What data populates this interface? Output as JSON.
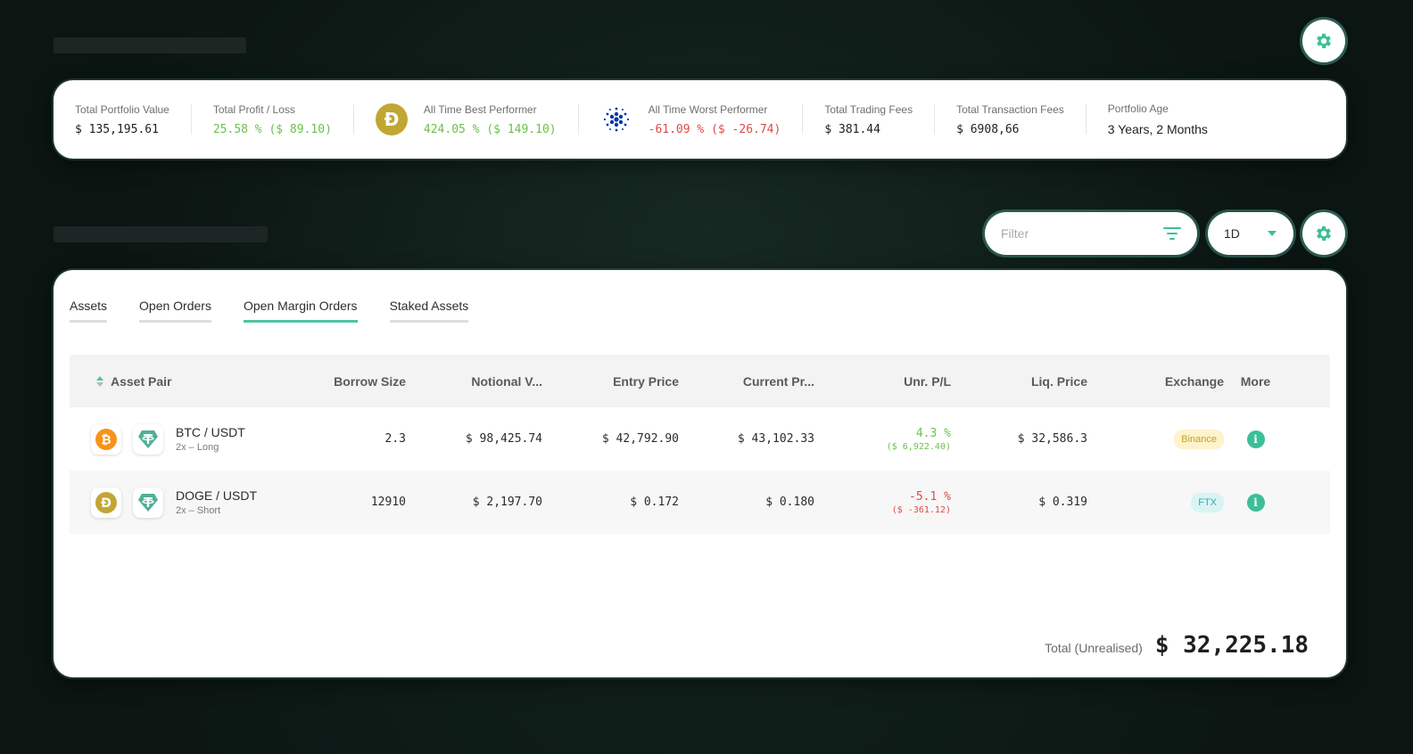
{
  "colors": {
    "accent": "#4fc4a4",
    "green": "#6cc04a",
    "red": "#e04848",
    "bitcoin": "#f7931a",
    "doge": "#c2a633",
    "tether": "#50af95",
    "cardano": "#0033ad"
  },
  "summary": {
    "total_portfolio_value": {
      "label": "Total Portfolio Value",
      "value": "$ 135,195.61"
    },
    "total_profit_loss": {
      "label": "Total Profit / Loss",
      "value": "25.58 % ($ 89.10)"
    },
    "best_performer": {
      "label": "All Time Best Performer",
      "value": "424.05 % ($ 149.10)",
      "icon": "doge-icon"
    },
    "worst_performer": {
      "label": "All Time Worst Performer",
      "value": "-61.09 % ($ -26.74)",
      "icon": "cardano-icon"
    },
    "trading_fees": {
      "label": "Total Trading Fees",
      "value": "$ 381.44"
    },
    "transaction_fees": {
      "label": "Total Transaction Fees",
      "value": "$ 6908,66"
    },
    "portfolio_age": {
      "label": "Portfolio Age",
      "value": "3 Years, 2 Months"
    }
  },
  "controls": {
    "filter_placeholder": "Filter",
    "period": "1D"
  },
  "tabs": [
    {
      "label": "Assets",
      "active": false
    },
    {
      "label": "Open Orders",
      "active": false
    },
    {
      "label": "Open Margin Orders",
      "active": true
    },
    {
      "label": "Staked Assets",
      "active": false
    }
  ],
  "table": {
    "headers": {
      "pair": "Asset Pair",
      "borrow": "Borrow Size",
      "notional": "Notional V...",
      "entry": "Entry Price",
      "current": "Current Pr...",
      "pl": "Unr. P/L",
      "liq": "Liq. Price",
      "exchange": "Exchange",
      "more": "More"
    },
    "rows": [
      {
        "pair": "BTC / USDT",
        "sub": "2x – Long",
        "icon": "bitcoin-icon",
        "borrow": "2.3",
        "notional": "$ 98,425.74",
        "entry": "$ 42,792.90",
        "current": "$ 43,102.33",
        "pl_pct": "4.3 %",
        "pl_abs": "($ 6,922.40)",
        "liq": "$ 32,586.3",
        "exchange": "Binance"
      },
      {
        "pair": "DOGE / USDT",
        "sub": "2x – Short",
        "icon": "doge-icon",
        "borrow": "12910",
        "notional": "$ 2,197.70",
        "entry": "$ 0.172",
        "current": "$ 0.180",
        "pl_pct": "-5.1 %",
        "pl_abs": "($ -361.12)",
        "liq": "$ 0.319",
        "exchange": "FTX"
      }
    ]
  },
  "total": {
    "label": "Total (Unrealised)",
    "value": "$ 32,225.18"
  }
}
